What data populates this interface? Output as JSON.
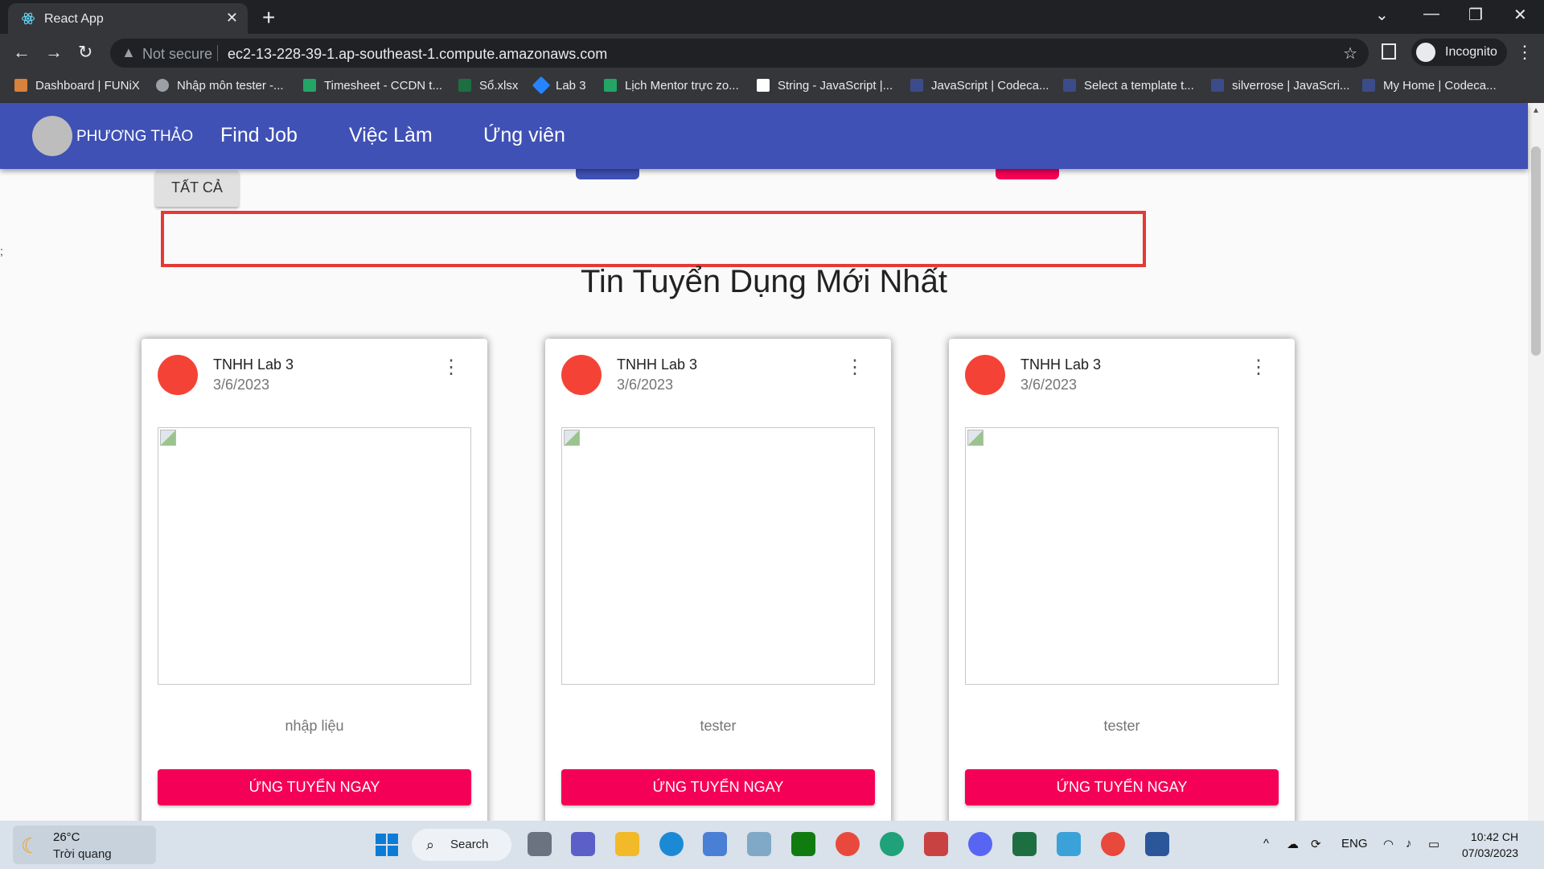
{
  "browser": {
    "tab_title": "React App",
    "tab_close": "✕",
    "new_tab": "+",
    "security_label": "Not secure",
    "url": "ec2-13-228-39-1.ap-southeast-1.compute.amazonaws.com",
    "incognito_label": "Incognito",
    "bookmarks": [
      {
        "label": "Dashboard | FUNiX",
        "color": "#d9823b"
      },
      {
        "label": "Nhập môn tester -...",
        "color": "#9aa0a6"
      },
      {
        "label": "Timesheet - CCDN t...",
        "color": "#23a566"
      },
      {
        "label": "Sổ.xlsx",
        "color": "#1d6f42"
      },
      {
        "label": "Lab 3",
        "color": "#2684ff"
      },
      {
        "label": "Lịch Mentor trực zo...",
        "color": "#23a566"
      },
      {
        "label": "String - JavaScript |...",
        "color": "#ffffff"
      },
      {
        "label": "JavaScript | Codeca...",
        "color": "#3c4b8a"
      },
      {
        "label": "Select a template t...",
        "color": "#3c4b8a"
      },
      {
        "label": "silverrose | JavaScri...",
        "color": "#3c4b8a"
      },
      {
        "label": "My Home | Codeca...",
        "color": "#3c4b8a"
      }
    ]
  },
  "app": {
    "brand_name": "PHƯƠNG THẢO",
    "nav": [
      "Find Job",
      "Việc Làm",
      "Ứng viên"
    ],
    "filter_all": "TẤT CẢ",
    "stray_text": ";",
    "section_title": "Tin Tuyển Dụng Mới Nhất",
    "cards": [
      {
        "company": "TNHH Lab 3",
        "date": "3/6/2023",
        "job": "nhập liệu",
        "apply": "ỨNG TUYỂN NGAY"
      },
      {
        "company": "TNHH Lab 3",
        "date": "3/6/2023",
        "job": "tester",
        "apply": "ỨNG TUYỂN NGAY"
      },
      {
        "company": "TNHH Lab 3",
        "date": "3/6/2023",
        "job": "tester",
        "apply": "ỨNG TUYỂN NGAY"
      }
    ],
    "colors": {
      "appbar": "#3f51b5",
      "accent": "#f50057"
    }
  },
  "taskbar": {
    "temperature": "26°C",
    "weather": "Trời quang",
    "search_label": "Search",
    "language": "ENG",
    "time": "10:42 CH",
    "date": "07/03/2023"
  }
}
